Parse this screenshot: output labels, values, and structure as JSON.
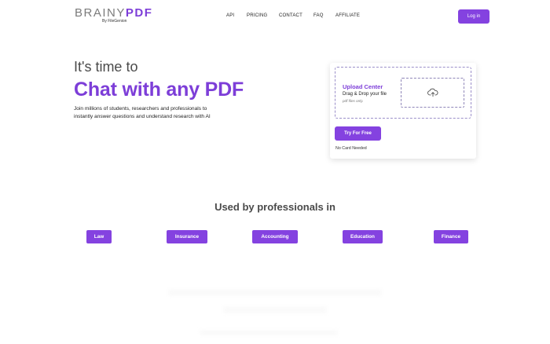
{
  "header": {
    "logo": {
      "brainy": "BRAINY",
      "pdf": "PDF",
      "byline": "By FileGenion"
    },
    "nav": [
      "API",
      "PRICING",
      "CONTACT",
      "FAQ",
      "AFFILIATE"
    ],
    "login_label": "Log in"
  },
  "hero": {
    "kicker": "It's time to",
    "title": "Chat with any PDF",
    "description": "Join millions of students, researchers and professionals to instantly answer questions and understand research with AI"
  },
  "upload": {
    "title": "Upload Center",
    "line1": "Drag & Drop your file",
    "line2": "pdf files only.",
    "cta_label": "Try For Free",
    "note": "No Card Needed"
  },
  "professionals": {
    "heading": "Used by professionals in",
    "tags": [
      "Law",
      "Insurance",
      "Accounting",
      "Education",
      "Finance"
    ]
  },
  "colors": {
    "accent": "#7d3ed8",
    "button": "#8442e0"
  },
  "icons": {
    "upload": "cloud-upload-icon"
  }
}
